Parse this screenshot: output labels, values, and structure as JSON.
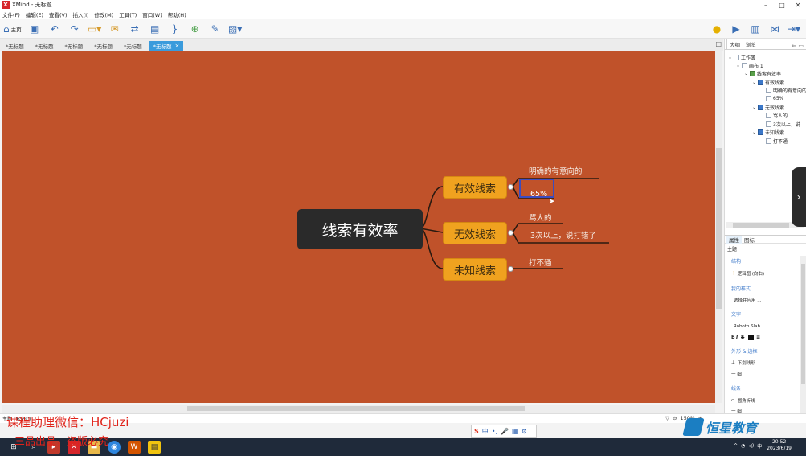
{
  "window": {
    "app_logo": "X",
    "title": "XMind - 无标题",
    "controls": [
      "–",
      "□",
      "✕"
    ]
  },
  "menu": {
    "items": [
      "文件(F)",
      "编辑(E)",
      "查看(V)",
      "插入(I)",
      "修改(M)",
      "工具(T)",
      "窗口(W)",
      "帮助(H)"
    ]
  },
  "toolbar": {
    "home_label": "主页",
    "icons": [
      "home-icon",
      "save-icon",
      "undo-icon",
      "redo-icon",
      "topic-icon",
      "callout-icon",
      "relationship-icon",
      "boundary-icon",
      "summary-icon",
      "marker-icon",
      "note-icon",
      "image-icon",
      "insight-icon",
      "presentation-icon",
      "layout-icon",
      "share-icon",
      "export-icon"
    ]
  },
  "tabs": {
    "items": [
      "*无标题",
      "*无标题",
      "*无标题",
      "*无标题",
      "*无标题"
    ],
    "active": "*无标题",
    "active_close": "×"
  },
  "mindmap": {
    "central": "线索有效率",
    "branches": [
      {
        "label": "有效线索",
        "leaves": [
          "明确的有意向的",
          "65%"
        ]
      },
      {
        "label": "无效线索",
        "leaves": [
          "骂人的",
          "3次以上，说打错了"
        ]
      },
      {
        "label": "未知线索",
        "leaves": [
          "打不通"
        ]
      }
    ],
    "canvas_color": "#c0522a",
    "central_color": "#2a2a2a",
    "branch_color": "#f0a21f",
    "selection_color": "#3b4cc0"
  },
  "outline_panel": {
    "tabs": [
      "大纲",
      "浏览"
    ],
    "tree": [
      {
        "label": "工作簿",
        "level": 0,
        "icon": "workbook-icon"
      },
      {
        "label": "画布 1",
        "level": 1,
        "icon": "sheet-icon"
      },
      {
        "label": "线索有效率",
        "level": 2,
        "icon": "root-topic-icon"
      },
      {
        "label": "有效线索",
        "level": 3,
        "icon": "topic-icon"
      },
      {
        "label": "明确的有意向的",
        "level": 4,
        "icon": "subtopic-icon"
      },
      {
        "label": "65%",
        "level": 4,
        "icon": "subtopic-icon"
      },
      {
        "label": "无效线索",
        "level": 3,
        "icon": "topic-icon"
      },
      {
        "label": "骂人的",
        "level": 4,
        "icon": "subtopic-icon"
      },
      {
        "label": "3次以上，说",
        "level": 4,
        "icon": "subtopic-icon"
      },
      {
        "label": "未知线索",
        "level": 3,
        "icon": "topic-icon"
      },
      {
        "label": "打不通",
        "level": 4,
        "icon": "subtopic-icon"
      }
    ]
  },
  "properties_panel": {
    "tabs": [
      "属性",
      "图标"
    ],
    "topic_label": "主题",
    "sections": {
      "structure_head": "结构",
      "structure_value": "逻辑图 (向右)",
      "style_head": "我的样式",
      "style_value": "选择并应用 ...",
      "text_head": "文字",
      "font_value": "Roboto Slab",
      "shape_head": "外形 & 边框",
      "shape_value": "下划线形",
      "shape_weight": "一 细",
      "line_head": "线条",
      "line_value": "圆角折线",
      "line_weight": "一 细"
    }
  },
  "status": {
    "left": "主题 ('65%')",
    "zoom": "150%"
  },
  "ime": {
    "logo": "S",
    "items": [
      "中",
      "•,",
      "🎤",
      "▦",
      "⚙"
    ]
  },
  "tray": {
    "time": "20:52",
    "date": "2023/6/19"
  },
  "watermark": {
    "line1": "课程助理微信：HCjuzi",
    "line2": "三品出品，盗版必究",
    "brand": "恒星教育"
  }
}
